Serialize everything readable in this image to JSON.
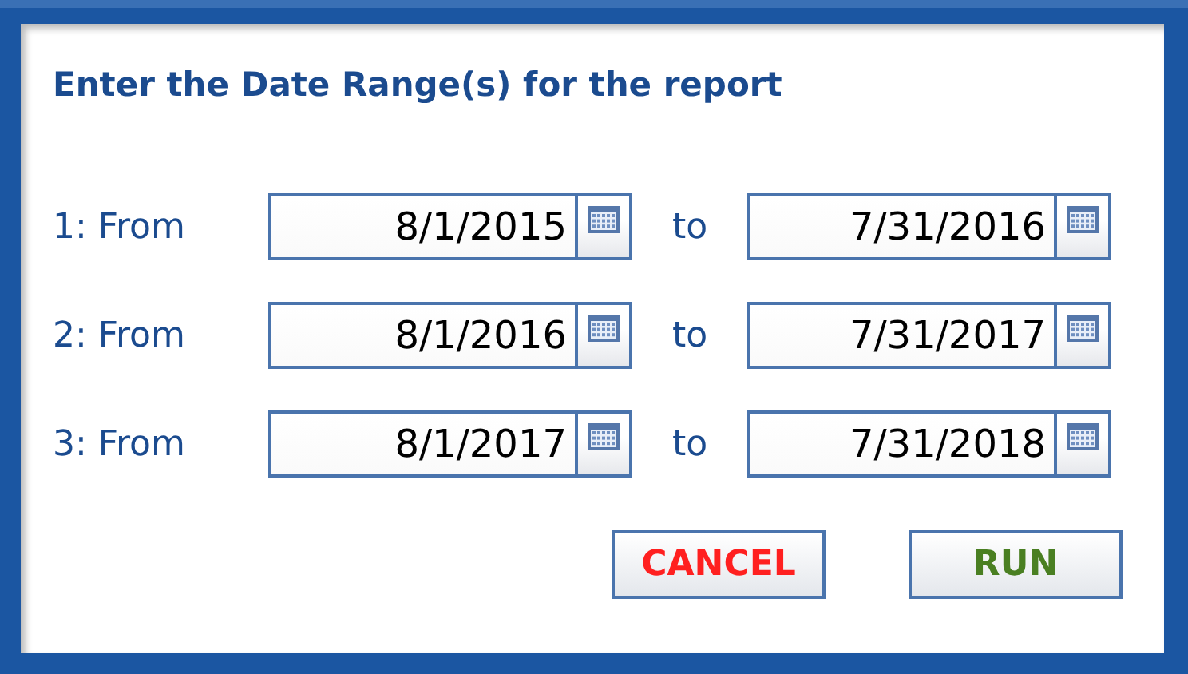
{
  "dialog": {
    "title": "Enter the Date Range(s) for the report"
  },
  "ranges": [
    {
      "label": "1: From",
      "from": "8/1/2015",
      "separator": "to",
      "to": "7/31/2016"
    },
    {
      "label": "2: From",
      "from": "8/1/2016",
      "separator": "to",
      "to": "7/31/2017"
    },
    {
      "label": "3: From",
      "from": "8/1/2017",
      "separator": "to",
      "to": "7/31/2018"
    }
  ],
  "buttons": [
    {
      "label": "CANCEL",
      "kind": "cancel"
    },
    {
      "label": "RUN",
      "kind": "run"
    }
  ]
}
